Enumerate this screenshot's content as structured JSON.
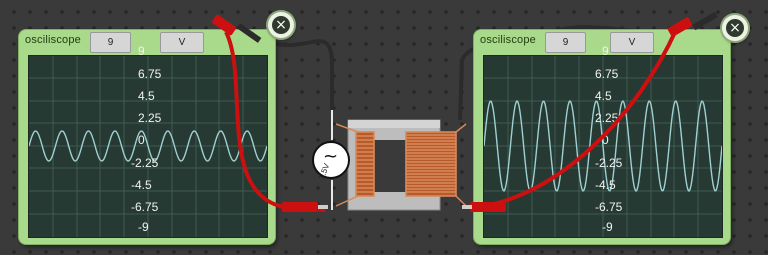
{
  "scopes": [
    {
      "title": "osciliscope",
      "volts_value": "9",
      "unit": "V",
      "close_glyph": "×",
      "tick_labels": [
        "9",
        "6.75",
        "4.5",
        "2.25",
        "0",
        "-2.25",
        "-4.5",
        "-6.75",
        "-9"
      ]
    },
    {
      "title": "osciliscope",
      "volts_value": "9",
      "unit": "V",
      "close_glyph": "×",
      "tick_labels": [
        "9",
        "6.75",
        "4.5",
        "2.25",
        "0",
        "-2.25",
        "-4.5",
        "-6.75",
        "-9"
      ]
    }
  ],
  "source": {
    "symbol": "~",
    "label": "1.5V"
  },
  "colors": {
    "probe_red": "#cc1010",
    "wire_black": "#2b2b2b",
    "trace": "#9fd0d2",
    "coil": "#d8895a",
    "scope_frame": "#a9d98a"
  }
}
